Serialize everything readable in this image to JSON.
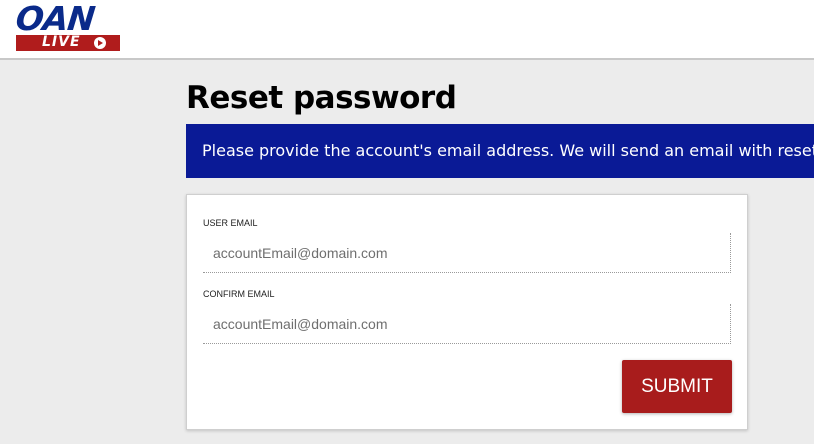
{
  "header": {
    "logo": {
      "main_text": "OAN",
      "sub_text": "LIVE",
      "icon": "play-icon"
    }
  },
  "page": {
    "title": "Reset password"
  },
  "banner": {
    "text": "Please provide the account's email address. We will send an email with reset"
  },
  "form": {
    "user_email": {
      "label": "USER EMAIL",
      "placeholder": "accountEmail@domain.com",
      "value": ""
    },
    "confirm_email": {
      "label": "CONFIRM EMAIL",
      "placeholder": "accountEmail@domain.com",
      "value": ""
    },
    "submit_label": "SUBMIT"
  },
  "colors": {
    "banner_bg": "#0a1a96",
    "submit_bg": "#a81c1c",
    "logo_blue": "#0a2a8a",
    "logo_red": "#b01c1c",
    "page_bg": "#ececec"
  }
}
